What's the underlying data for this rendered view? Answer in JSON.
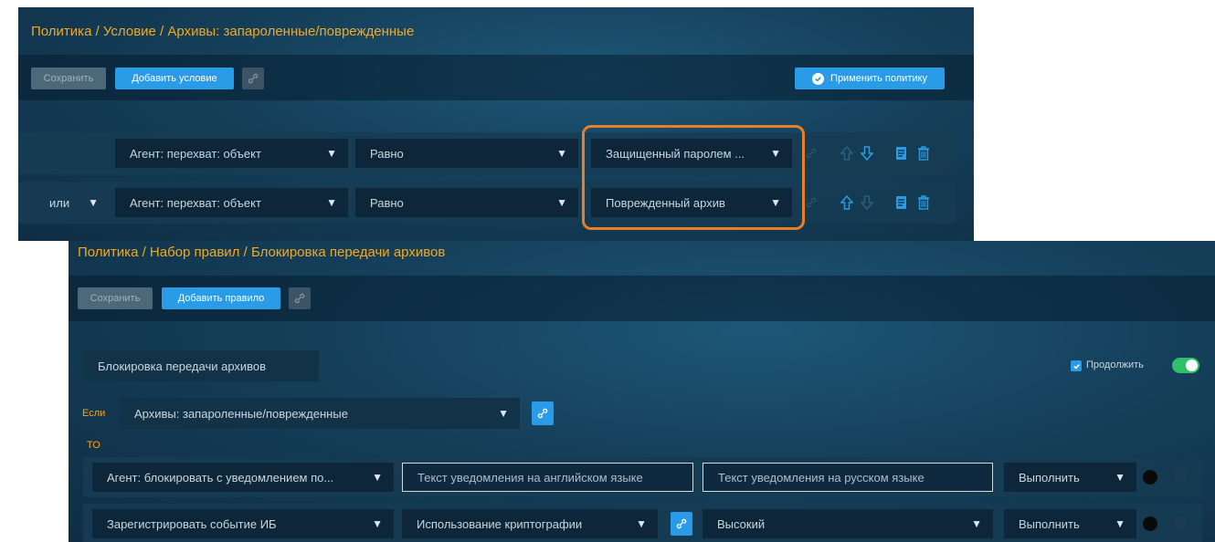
{
  "panel1": {
    "breadcrumb": "Политика / Условие / Архивы: запароленные/поврежденные",
    "toolbar": {
      "save_label": "Сохранить",
      "add_condition_label": "Добавить условие",
      "apply_policy_label": "Применить политику"
    },
    "rows": [
      {
        "logic": "",
        "field": "Агент: перехват: объект",
        "operator": "Равно",
        "value": "Защищенный паролем ..."
      },
      {
        "logic": "или",
        "field": "Агент: перехват: объект",
        "operator": "Равно",
        "value": "Поврежденный архив"
      }
    ]
  },
  "panel2": {
    "breadcrumb": "Политика / Набор правил / Блокировка передачи архивов",
    "toolbar": {
      "save_label": "Сохранить",
      "add_rule_label": "Добавить правило"
    },
    "rule_name": "Блокировка передачи архивов",
    "continue_label": "Продолжить",
    "continue_checked": true,
    "toggle_on": true,
    "if_label": "Если",
    "condition": "Архивы: запароленные/поврежденные",
    "then_label": "то",
    "actions": [
      {
        "action": "Агент: блокировать с уведомлением по...",
        "param1": "Текст уведомления на английском языке",
        "param2": "Текст уведомления на русском языке",
        "mode": "Выполнить"
      },
      {
        "action": "Зарегистрировать событие ИБ",
        "param1": "Использование криптографии",
        "param2": "Высокий",
        "mode": "Выполнить"
      }
    ]
  },
  "colors": {
    "accent_orange": "#f4a81d",
    "highlight_orange": "#e87f28",
    "button_blue": "#2a9be6",
    "toggle_green": "#2fc06a"
  }
}
